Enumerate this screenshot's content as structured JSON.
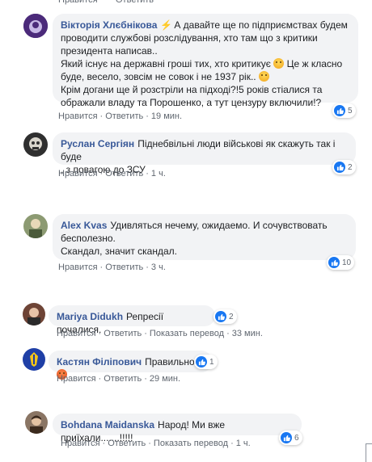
{
  "actions": {
    "like": "Нравится",
    "reply": "Ответить",
    "translate": "Показать перевод",
    "dot": "·"
  },
  "comments": [
    {
      "author": "Вікторія Хлєбнікова",
      "lines": [
        "А давайте ще по підприємствах будем",
        "проводити службові розслідування, хто там що з критики",
        "президента написав..",
        "Який існує на державні гроші тих, хто критикує",
        "Це ж класно",
        "буде, весело, зовсім не совок і не 1937 рік..",
        "Крім догани ще й розстріли на підході?!5 років стіалися та",
        "ображали владу та Порошенко, а тут цензуру включили!?"
      ],
      "time": "19 мин.",
      "reactions": "5",
      "avatar_color": "#4b2a7a"
    },
    {
      "author": "Руслан Сергіян",
      "text1": "Піднебвільні люди військові як скажуть так і буде",
      "text2": ", з повагою до ЗСУ",
      "time": "1 ч.",
      "reactions": "2",
      "avatar_color": "#3b3b3b"
    },
    {
      "author": "Alex Kvas",
      "text1": "Удивляться нечему, ожидаемо. И сочувствовать",
      "text2": "бесполезно.",
      "text3": "Скандал, значит скандал.",
      "time": "3 ч.",
      "reactions": "10",
      "avatar_color": "#6b7a54"
    },
    {
      "author": "Mariya Didukh",
      "text1": "Репресії почалися.",
      "time": "33 мин.",
      "reactions": "2",
      "avatar_color": "#7a4b3a"
    },
    {
      "author": "Кастян Філіпович",
      "text1": "Правильно",
      "time": "29 мин.",
      "reactions": "1",
      "avatar_color": "#1f3fa6"
    },
    {
      "author": "Bohdana Maidanska",
      "text1": "Народ! Ми вже приїхали.......!!!!!",
      "time": "1 ч.",
      "reactions": "6",
      "avatar_color": "#5a4636"
    }
  ]
}
